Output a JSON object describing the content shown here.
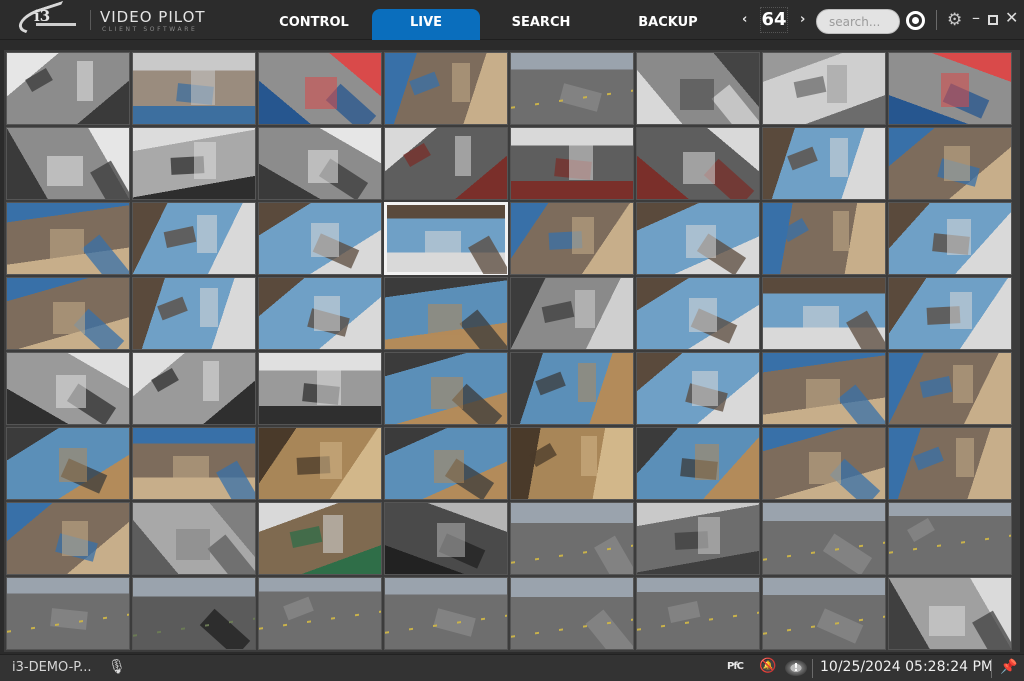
{
  "app": {
    "brand_title": "VIDEO PILOT",
    "brand_subtitle": "CLIENT SOFTWARE",
    "logo_text": "i3"
  },
  "tabs": [
    {
      "label": "CONTROL",
      "active": false
    },
    {
      "label": "LIVE",
      "active": true
    },
    {
      "label": "SEARCH",
      "active": false
    },
    {
      "label": "BACKUP",
      "active": false
    }
  ],
  "pager": {
    "prev": "‹",
    "value": "64",
    "next": "›"
  },
  "search": {
    "placeholder": "search..."
  },
  "window_controls": {
    "settings": "⚙",
    "minimize": "–",
    "close": "✕"
  },
  "camera_grid": {
    "rows": 8,
    "columns": 8,
    "selected_tile": {
      "row": 3,
      "column": 4
    },
    "tiles": [
      "office",
      "office-lobby",
      "office-desks",
      "warehouse-shelves",
      "parking-lot",
      "office-hall",
      "empty-room",
      "office-desks",
      "office",
      "office-door",
      "office",
      "conference-room",
      "conference-room",
      "conference-room",
      "warehouse-floor",
      "warehouse-shelves",
      "warehouse-shelves",
      "warehouse-floor",
      "warehouse-floor",
      "warehouse-floor",
      "warehouse-shelves",
      "warehouse-floor",
      "warehouse-shelves",
      "warehouse-floor",
      "warehouse-shelves",
      "warehouse-floor",
      "warehouse-floor",
      "warehouse-aisle",
      "warehouse-bw",
      "warehouse-floor",
      "warehouse-floor",
      "warehouse-floor",
      "office-bw",
      "office-bw",
      "office-bw",
      "warehouse-aisle",
      "warehouse-aisle",
      "warehouse-floor",
      "warehouse-shelves",
      "warehouse-shelves",
      "warehouse-aisle",
      "warehouse-shelves",
      "warehouse-boxes",
      "warehouse-aisle",
      "warehouse-boxes",
      "warehouse-aisle",
      "warehouse-shelves",
      "warehouse-shelves",
      "warehouse-shelves",
      "exterior-wall",
      "mezzanine",
      "server-room",
      "parking-lot",
      "loading-dock",
      "parking-lot",
      "parking-lot",
      "parking-lot",
      "parking-cars",
      "parking-lot",
      "parking-lot",
      "parking-lot",
      "parking-lot",
      "parking-lot",
      "store-bw"
    ],
    "palettes": {
      "office": [
        "#8c8c8c",
        "#3a3a3a",
        "#e6e6e6"
      ],
      "office-lobby": [
        "#9a8c7e",
        "#3d6f9f",
        "#c9c9c9"
      ],
      "office-desks": [
        "#8f8f8f",
        "#26568f",
        "#d94a4a"
      ],
      "warehouse-shelves": [
        "#7d6c5c",
        "#3870a8",
        "#c7ae8a"
      ],
      "parking-lot": [
        "#6e6e6e",
        "#8a8a8a",
        "#c9b24a"
      ],
      "office-hall": [
        "#8a8a8a",
        "#d8d8d8",
        "#444"
      ],
      "empty-room": [
        "#cfcfcf",
        "#6c6c6c",
        "#999"
      ],
      "office-door": [
        "#a9a9a9",
        "#2e2e2e",
        "#dcdcdc"
      ],
      "conference-room": [
        "#5e5e5e",
        "#7a2f2a",
        "#d9d9d9"
      ],
      "warehouse-floor": [
        "#6fa0c6",
        "#5a4a3c",
        "#d9d9d9"
      ],
      "warehouse-aisle": [
        "#5b8fb8",
        "#3b3b3b",
        "#b38b5a"
      ],
      "warehouse-bw": [
        "#8a8a8a",
        "#3c3c3c",
        "#cfcfcf"
      ],
      "office-bw": [
        "#9a9a9a",
        "#2f2f2f",
        "#e0e0e0"
      ],
      "warehouse-boxes": [
        "#a88658",
        "#4a3a2a",
        "#d2b78a"
      ],
      "exterior-wall": [
        "#a8a8a8",
        "#5d5d5d",
        "#7f7f7f"
      ],
      "mezzanine": [
        "#7f6a50",
        "#2f6e48",
        "#d9d9d9"
      ],
      "server-room": [
        "#4a4a4a",
        "#222",
        "#b5b5b5"
      ],
      "loading-dock": [
        "#6d6d6d",
        "#3f3f3f",
        "#c9c9c9"
      ],
      "parking-cars": [
        "#5b5b5b",
        "#1e1e1e",
        "#6b7a55"
      ],
      "store-bw": [
        "#a0a0a0",
        "#404040",
        "#dadada"
      ]
    }
  },
  "statusbar": {
    "host": "i3-DEMO-P...",
    "mic_icon": "🎙",
    "pfc_label": "PfC",
    "bell_icon": "🔕",
    "alert_label": "!",
    "datetime": "10/25/2024 05:28:24 PM",
    "pin_icon": "📌"
  }
}
